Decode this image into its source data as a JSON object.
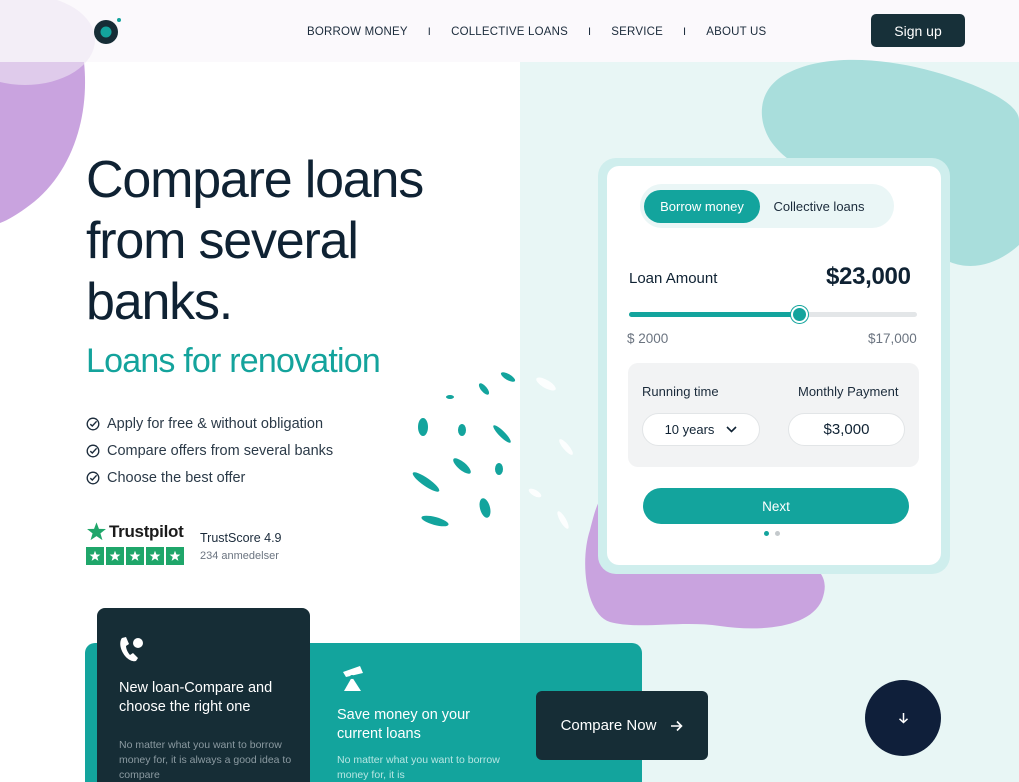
{
  "nav": {
    "items": [
      "BORROW MONEY",
      "COLLECTIVE LOANS",
      "SERVICE",
      "ABOUT US"
    ],
    "separator": "I",
    "signup_label": "Sign up"
  },
  "hero": {
    "title_lines": [
      "Compare loans",
      "from several",
      "banks."
    ],
    "subtitle": "Loans for renovation",
    "features": [
      "Apply for free & without obligation",
      "Compare offers from several banks",
      "Choose the best offer"
    ]
  },
  "trustpilot": {
    "brand": "Trustpilot",
    "score_text": "TrustScore 4.9",
    "reviews_text": "234 anmedelser",
    "stars": 5
  },
  "calculator": {
    "tabs": [
      "Borrow money",
      "Collective loans"
    ],
    "active_tab": "Borrow money",
    "amount_label": "Loan Amount",
    "amount_value": "$23,000",
    "slider_min_label": "$ 2000",
    "slider_max_label": "$17,000",
    "slider_fraction": 0.59,
    "running_time_label": "Running time",
    "running_time_value": "10 years",
    "monthly_payment_label": "Monthly Payment",
    "monthly_payment_value": "$3,000",
    "next_label": "Next",
    "steps": 2,
    "current_step": 1
  },
  "panels": {
    "new_loan": {
      "title": "New loan-Compare and choose the right one",
      "text": "No matter what you want to borrow money for, it is always a good idea to compare"
    },
    "save_money": {
      "title": "Save money on your current loans",
      "text": "No matter what you want to borrow money for, it is"
    },
    "compare_label": "Compare Now"
  },
  "colors": {
    "teal": "#13a49d",
    "dark": "#162d36",
    "navy": "#0f1f3a",
    "purple": "#c9a3df",
    "light_teal": "#a9dedc"
  },
  "icons": {
    "logo": "logo-icon",
    "check": "check-circle-icon",
    "chevron": "chevron-down-icon",
    "arrow_right": "arrow-right-icon",
    "arrow_down": "arrow-down-icon",
    "phone": "phone-icon",
    "piggy": "piggy-bank-icon",
    "star": "star-icon"
  }
}
